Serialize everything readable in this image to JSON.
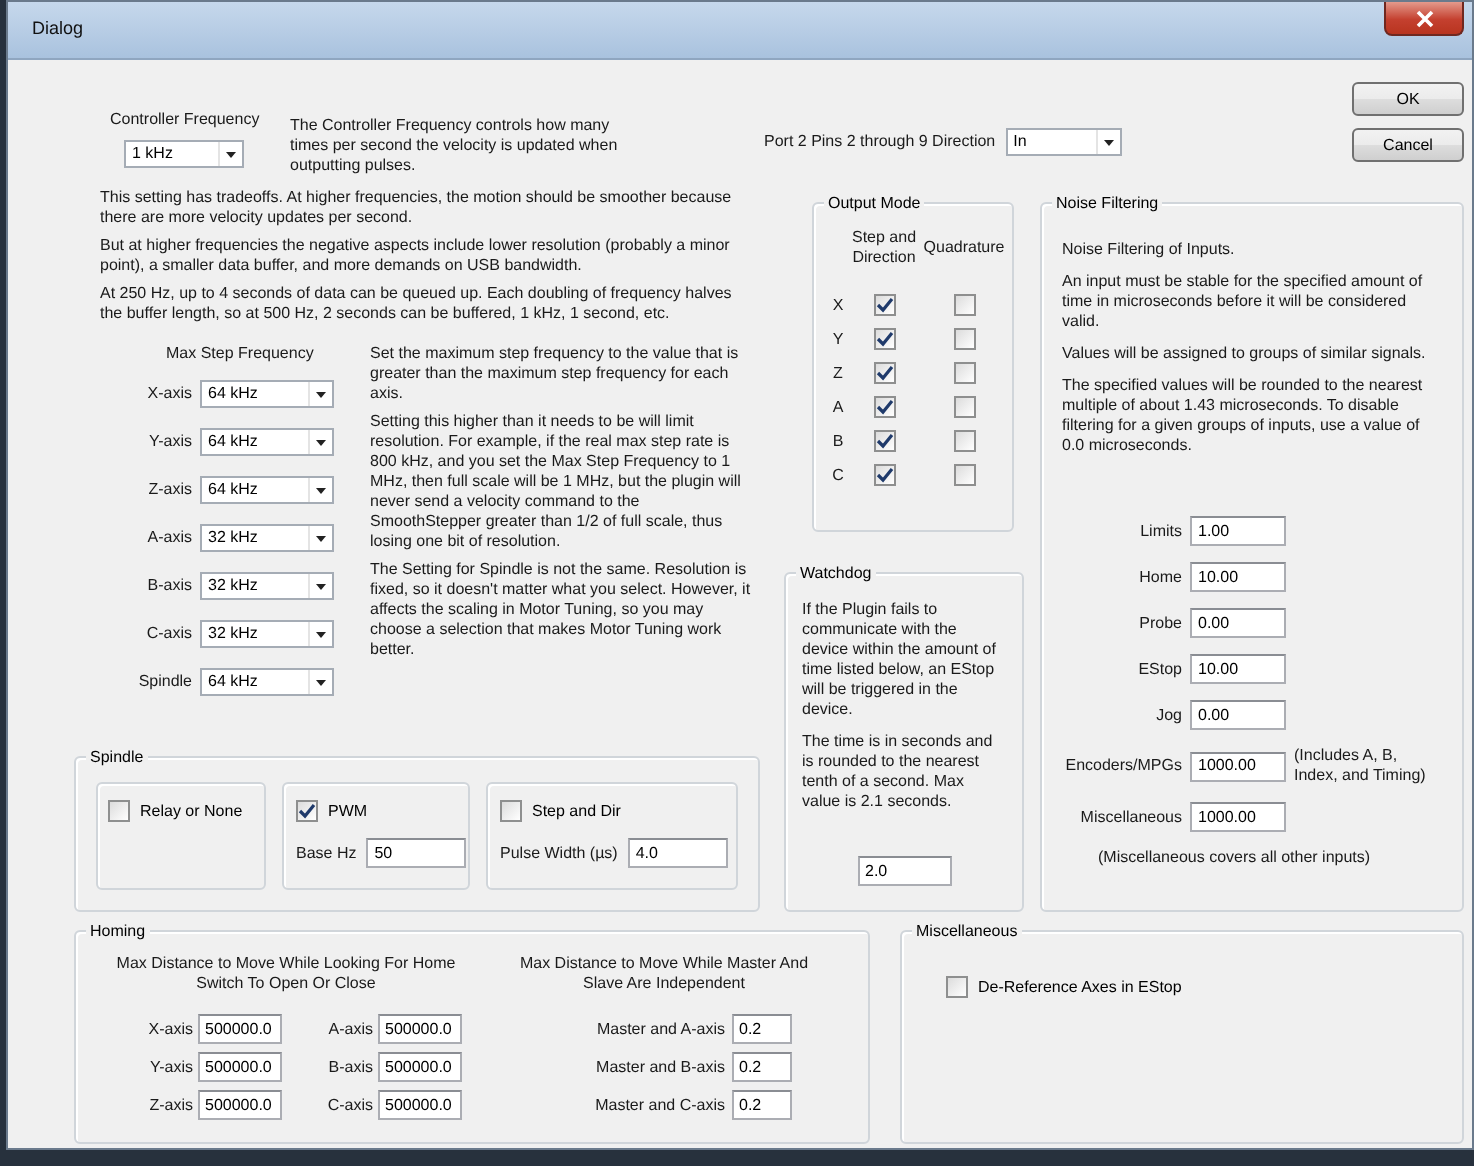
{
  "window": {
    "title": "Dialog"
  },
  "controller_frequency": {
    "label": "Controller Frequency",
    "value": "1 kHz",
    "description": "The Controller Frequency controls how many times per second the velocity is updated when outputting pulses."
  },
  "notes": [
    "This setting has tradeoffs.  At higher frequencies, the motion should be smoother because there are more velocity updates per second.",
    "But at higher frequencies the negative aspects include lower resolution (probably a minor point), a smaller data buffer, and more demands on USB bandwidth.",
    "At 250 Hz, up to 4 seconds of data can be queued up.  Each doubling of frequency halves the buffer length, so at 500 Hz, 2 seconds can be buffered, 1 kHz, 1 second, etc."
  ],
  "max_step_frequency": {
    "label": "Max Step Frequency",
    "axes": [
      {
        "label": "X-axis",
        "value": "64 kHz"
      },
      {
        "label": "Y-axis",
        "value": "64 kHz"
      },
      {
        "label": "Z-axis",
        "value": "64 kHz"
      },
      {
        "label": "A-axis",
        "value": "32 kHz"
      },
      {
        "label": "B-axis",
        "value": "32 kHz"
      },
      {
        "label": "C-axis",
        "value": "32 kHz"
      },
      {
        "label": "Spindle",
        "value": "64 kHz"
      }
    ],
    "description": [
      "Set the maximum step frequency to the value that is greater than the maximum step frequency for each axis.",
      "Setting this higher than it needs to be will limit resolution.  For example, if the real max step rate is 800 kHz, and you set the Max Step Frequency to 1 MHz, then full scale will be 1 MHz, but the plugin will never send a velocity command to the SmoothStepper greater than 1/2 of full scale, thus losing one bit of resolution.",
      "The Setting for Spindle is not the same. Resolution is fixed, so it doesn't matter what you select.  However, it affects the scaling in Motor Tuning, so you may choose a selection that makes Motor Tuning work better."
    ]
  },
  "spindle": {
    "title": "Spindle",
    "options": [
      {
        "label": "Relay or None",
        "checked": false
      },
      {
        "label": "PWM",
        "checked": true,
        "field": {
          "label": "Base Hz",
          "value": "50"
        }
      },
      {
        "label": "Step and Dir",
        "checked": false,
        "field": {
          "label": "Pulse Width (µs)",
          "value": "4.0"
        }
      }
    ]
  },
  "port_direction": {
    "label": "Port 2 Pins 2 through 9 Direction",
    "value": "In"
  },
  "buttons": [
    "OK",
    "Cancel"
  ],
  "output_mode": {
    "title": "Output Mode",
    "columns": [
      "Step and Direction",
      "Quadrature"
    ],
    "rows": [
      {
        "axis": "X",
        "step_and_direction": true,
        "quadrature": false
      },
      {
        "axis": "Y",
        "step_and_direction": true,
        "quadrature": false
      },
      {
        "axis": "Z",
        "step_and_direction": true,
        "quadrature": false
      },
      {
        "axis": "A",
        "step_and_direction": true,
        "quadrature": false
      },
      {
        "axis": "B",
        "step_and_direction": true,
        "quadrature": false
      },
      {
        "axis": "C",
        "step_and_direction": true,
        "quadrature": false
      }
    ]
  },
  "watchdog": {
    "title": "Watchdog",
    "paragraphs": [
      "If the Plugin fails to communicate with the device within the amount of time listed below, an EStop will be triggered in the device.",
      "The time is in seconds and is rounded to the nearest tenth of a second.  Max value is 2.1 seconds."
    ],
    "value": "2.0"
  },
  "noise_filtering": {
    "title": "Noise Filtering",
    "paragraphs": [
      "Noise Filtering of Inputs.",
      "An input must be stable for the specified amount of time in microseconds before it will be considered valid.",
      "Values will be assigned to groups of similar signals.",
      "The specified values will be rounded to the nearest multiple of about 1.43 microseconds.  To disable filtering for a given groups of inputs, use a value of 0.0 microseconds."
    ],
    "fields": [
      {
        "label": "Limits",
        "value": "1.00"
      },
      {
        "label": "Home",
        "value": "10.00"
      },
      {
        "label": "Probe",
        "value": "0.00"
      },
      {
        "label": "EStop",
        "value": "10.00"
      },
      {
        "label": "Jog",
        "value": "0.00"
      },
      {
        "label": "Encoders/MPGs",
        "value": "1000.00",
        "note": "(Includes A, B, Index, and Timing)"
      },
      {
        "label": "Miscellaneous",
        "value": "1000.00"
      }
    ],
    "footnote": "(Miscellaneous covers all other inputs)"
  },
  "homing": {
    "title": "Homing",
    "home_heading": "Max Distance to Move While Looking For Home Switch To Open Or Close",
    "home_fields": [
      {
        "label": "X-axis",
        "value": "500000.0"
      },
      {
        "label": "A-axis",
        "value": "500000.0"
      },
      {
        "label": "Y-axis",
        "value": "500000.0"
      },
      {
        "label": "B-axis",
        "value": "500000.0"
      },
      {
        "label": "Z-axis",
        "value": "500000.0"
      },
      {
        "label": "C-axis",
        "value": "500000.0"
      }
    ],
    "slave_heading": "Max Distance to Move While Master And Slave Are Independent",
    "slave_fields": [
      {
        "label": "Master and A-axis",
        "value": "0.2"
      },
      {
        "label": "Master and B-axis",
        "value": "0.2"
      },
      {
        "label": "Master and C-axis",
        "value": "0.2"
      }
    ]
  },
  "miscellaneous": {
    "title": "Miscellaneous",
    "options": [
      {
        "label": "De-Reference Axes in EStop",
        "checked": false
      }
    ]
  }
}
